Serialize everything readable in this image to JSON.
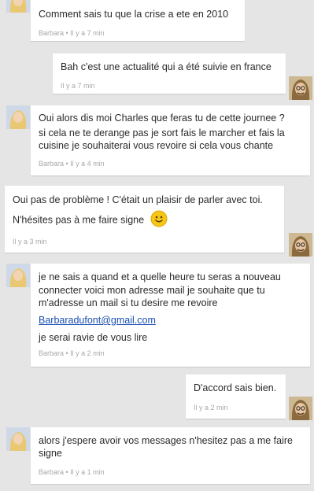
{
  "messages": [
    {
      "sender": "Barbara",
      "lines": [
        "Comment sais tu que la crise a ete en 2010"
      ],
      "meta": "Barbara • Il y a 7 min"
    },
    {
      "sender": "Charles",
      "lines": [
        "Bah c'est une actualité qui a été suivie en france"
      ],
      "meta": "Il y a 7 min"
    },
    {
      "sender": "Barbara",
      "lines": [
        "Oui alors dis moi Charles que feras tu de cette journee ?",
        "si cela ne te derange pas je sort fais le marcher et fais la",
        "cuisine je souhaiterai vous revoire si cela vous chante"
      ],
      "meta": "Barbara • Il y a 4 min"
    },
    {
      "sender": "Charles",
      "lines": [
        "Oui pas de problème ! C'était un plaisir de parler avec toi.",
        "N'hésites pas à me faire signe"
      ],
      "meta": "Il y a 3 min",
      "emoji": "smiley-emoji"
    },
    {
      "sender": "Barbara",
      "lines": [
        "je ne sais a quand et a quelle heure tu seras a nouveau",
        "connecter voici mon adresse mail je souhaite que tu",
        "m'adresse un mail si tu desire me revoire"
      ],
      "email": "Barbaradufont@gmail.com",
      "after_email": "je serai ravie de vous lire",
      "meta": "Barbara • Il y a 2 min"
    },
    {
      "sender": "Charles",
      "lines": [
        "D'accord sais bien."
      ],
      "meta": "Il y a 2 min"
    },
    {
      "sender": "Barbara",
      "lines": [
        "alors j'espere avoir vos messages n'hesitez pas a me faire",
        "signe"
      ],
      "meta": "Barbara • Il y a 1 min"
    }
  ],
  "colors": {
    "background": "#e5e5e5",
    "bubble": "#ffffff",
    "meta_text": "#a8a8a8",
    "link": "#1a4fb0",
    "smiley": "#f5c518"
  },
  "icons": {
    "barbara_avatar": "blonde-woman-avatar-icon",
    "charles_avatar": "man-with-glasses-avatar-icon"
  }
}
